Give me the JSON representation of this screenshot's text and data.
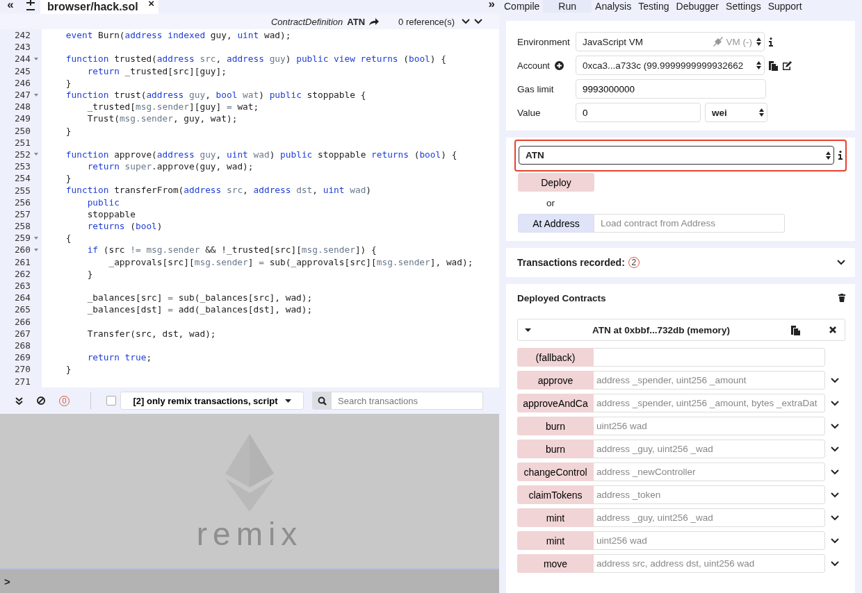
{
  "editor": {
    "file_tab": {
      "label": "browser/hack.sol",
      "close": "×"
    },
    "nav_left": "«",
    "nav_right": "»",
    "header": {
      "kind_label": "ContractDefinition",
      "name": "ATN",
      "references": "0 reference(s)"
    },
    "lines": [
      {
        "number": "242",
        "fold": false,
        "tokens": [
          {
            "kind": "keyword",
            "text": "    event"
          },
          {
            "kind": "plain",
            "text": " Burn("
          },
          {
            "kind": "keyword",
            "text": "address indexed"
          },
          {
            "kind": "plain",
            "text": " guy, "
          },
          {
            "kind": "keyword",
            "text": "uint"
          },
          {
            "kind": "plain",
            "text": " wad);"
          }
        ]
      },
      {
        "number": "243",
        "fold": false
      },
      {
        "number": "244",
        "fold": true,
        "tokens": [
          {
            "kind": "keyword",
            "text": "    function"
          },
          {
            "kind": "plain",
            "text": " trusted("
          },
          {
            "kind": "keyword",
            "text": "address"
          },
          {
            "kind": "param",
            "text": " src"
          },
          {
            "kind": "plain",
            "text": ", "
          },
          {
            "kind": "keyword",
            "text": "address"
          },
          {
            "kind": "param",
            "text": " guy"
          },
          {
            "kind": "plain",
            "text": ") "
          },
          {
            "kind": "keyword",
            "text": "public view returns"
          },
          {
            "kind": "plain",
            "text": " ("
          },
          {
            "kind": "keyword",
            "text": "bool"
          },
          {
            "kind": "plain",
            "text": ") {"
          }
        ]
      },
      {
        "number": "245",
        "fold": false,
        "tokens": [
          {
            "kind": "keyword",
            "text": "        return"
          },
          {
            "kind": "plain",
            "text": " _trusted[src][guy];"
          }
        ]
      },
      {
        "number": "246",
        "fold": false,
        "tokens": [
          {
            "kind": "plain",
            "text": "    }"
          }
        ]
      },
      {
        "number": "247",
        "fold": true,
        "tokens": [
          {
            "kind": "keyword",
            "text": "    function"
          },
          {
            "kind": "plain",
            "text": " trust("
          },
          {
            "kind": "keyword",
            "text": "address"
          },
          {
            "kind": "param",
            "text": " guy"
          },
          {
            "kind": "plain",
            "text": ", "
          },
          {
            "kind": "keyword",
            "text": "bool"
          },
          {
            "kind": "param",
            "text": " wat"
          },
          {
            "kind": "plain",
            "text": ") "
          },
          {
            "kind": "keyword",
            "text": "public"
          },
          {
            "kind": "plain",
            "text": " stoppable {"
          }
        ]
      },
      {
        "number": "248",
        "fold": false,
        "tokens": [
          {
            "kind": "plain",
            "text": "        _trusted["
          },
          {
            "kind": "param",
            "text": "msg.sender"
          },
          {
            "kind": "plain",
            "text": "][guy] "
          },
          {
            "kind": "param",
            "text": "="
          },
          {
            "kind": "plain",
            "text": " wat;"
          }
        ]
      },
      {
        "number": "249",
        "fold": false,
        "tokens": [
          {
            "kind": "plain",
            "text": "        Trust("
          },
          {
            "kind": "param",
            "text": "msg.sender"
          },
          {
            "kind": "plain",
            "text": ", guy, wat);"
          }
        ]
      },
      {
        "number": "250",
        "fold": false,
        "tokens": [
          {
            "kind": "plain",
            "text": "    }"
          }
        ]
      },
      {
        "number": "251",
        "fold": false
      },
      {
        "number": "252",
        "fold": true,
        "tokens": [
          {
            "kind": "keyword",
            "text": "    function"
          },
          {
            "kind": "plain",
            "text": " approve("
          },
          {
            "kind": "keyword",
            "text": "address"
          },
          {
            "kind": "param",
            "text": " guy"
          },
          {
            "kind": "plain",
            "text": ", "
          },
          {
            "kind": "keyword",
            "text": "uint"
          },
          {
            "kind": "param",
            "text": " wad"
          },
          {
            "kind": "plain",
            "text": ") "
          },
          {
            "kind": "keyword",
            "text": "public"
          },
          {
            "kind": "plain",
            "text": " stoppable "
          },
          {
            "kind": "keyword",
            "text": "returns"
          },
          {
            "kind": "plain",
            "text": " ("
          },
          {
            "kind": "keyword",
            "text": "bool"
          },
          {
            "kind": "plain",
            "text": ") {"
          }
        ]
      },
      {
        "number": "253",
        "fold": false,
        "tokens": [
          {
            "kind": "keyword",
            "text": "        return"
          },
          {
            "kind": "param",
            "text": " super"
          },
          {
            "kind": "plain",
            "text": ".approve(guy, wad);"
          }
        ]
      },
      {
        "number": "254",
        "fold": false,
        "tokens": [
          {
            "kind": "plain",
            "text": "    }"
          }
        ]
      },
      {
        "number": "255",
        "fold": false,
        "tokens": [
          {
            "kind": "keyword",
            "text": "    function"
          },
          {
            "kind": "plain",
            "text": " transferFrom("
          },
          {
            "kind": "keyword",
            "text": "address"
          },
          {
            "kind": "param",
            "text": " src"
          },
          {
            "kind": "plain",
            "text": ", "
          },
          {
            "kind": "keyword",
            "text": "address"
          },
          {
            "kind": "param",
            "text": " dst"
          },
          {
            "kind": "plain",
            "text": ", "
          },
          {
            "kind": "keyword",
            "text": "uint"
          },
          {
            "kind": "param",
            "text": " wad"
          },
          {
            "kind": "plain",
            "text": ")"
          }
        ]
      },
      {
        "number": "256",
        "fold": false,
        "tokens": [
          {
            "kind": "keyword",
            "text": "        public"
          }
        ]
      },
      {
        "number": "257",
        "fold": false,
        "tokens": [
          {
            "kind": "plain",
            "text": "        stoppable"
          }
        ]
      },
      {
        "number": "258",
        "fold": false,
        "tokens": [
          {
            "kind": "keyword",
            "text": "        returns"
          },
          {
            "kind": "plain",
            "text": " ("
          },
          {
            "kind": "keyword",
            "text": "bool"
          },
          {
            "kind": "plain",
            "text": ")"
          }
        ]
      },
      {
        "number": "259",
        "fold": true,
        "tokens": [
          {
            "kind": "plain",
            "text": "    {"
          }
        ]
      },
      {
        "number": "260",
        "fold": true,
        "tokens": [
          {
            "kind": "keyword",
            "text": "        if"
          },
          {
            "kind": "plain",
            "text": " (src "
          },
          {
            "kind": "param",
            "text": "!= msg.sender"
          },
          {
            "kind": "plain",
            "text": " && !_trusted[src]["
          },
          {
            "kind": "param",
            "text": "msg.sender"
          },
          {
            "kind": "plain",
            "text": "]) {"
          }
        ]
      },
      {
        "number": "261",
        "fold": false,
        "tokens": [
          {
            "kind": "plain",
            "text": "            _approvals[src]["
          },
          {
            "kind": "param",
            "text": "msg.sender"
          },
          {
            "kind": "plain",
            "text": "] "
          },
          {
            "kind": "param",
            "text": "="
          },
          {
            "kind": "plain",
            "text": " sub(_approvals[src]["
          },
          {
            "kind": "param",
            "text": "msg.sender"
          },
          {
            "kind": "plain",
            "text": "], wad);"
          }
        ]
      },
      {
        "number": "262",
        "fold": false,
        "tokens": [
          {
            "kind": "plain",
            "text": "        }"
          }
        ]
      },
      {
        "number": "263",
        "fold": false
      },
      {
        "number": "264",
        "fold": false,
        "tokens": [
          {
            "kind": "plain",
            "text": "        _balances[src] "
          },
          {
            "kind": "param",
            "text": "="
          },
          {
            "kind": "plain",
            "text": " sub(_balances[src], wad);"
          }
        ]
      },
      {
        "number": "265",
        "fold": false,
        "tokens": [
          {
            "kind": "plain",
            "text": "        _balances[dst] "
          },
          {
            "kind": "param",
            "text": "="
          },
          {
            "kind": "plain",
            "text": " add(_balances[dst], wad);"
          }
        ]
      },
      {
        "number": "266",
        "fold": false
      },
      {
        "number": "267",
        "fold": false,
        "tokens": [
          {
            "kind": "plain",
            "text": "        Transfer(src, dst, wad);"
          }
        ]
      },
      {
        "number": "268",
        "fold": false
      },
      {
        "number": "269",
        "fold": false,
        "tokens": [
          {
            "kind": "keyword",
            "text": "        return true"
          },
          {
            "kind": "plain",
            "text": ";"
          }
        ]
      },
      {
        "number": "270",
        "fold": false,
        "tokens": [
          {
            "kind": "plain",
            "text": "    }"
          }
        ]
      },
      {
        "number": "271",
        "fold": false
      }
    ]
  },
  "terminal": {
    "error_count": "0",
    "filter_checked": false,
    "filter": "[2] only remix transactions, script",
    "search": {
      "placeholder": "Search transactions"
    },
    "logo_text": "remix",
    "prompt": ">"
  },
  "tabs": [
    {
      "label": "Compile",
      "selected": false
    },
    {
      "label": "Run",
      "selected": true
    },
    {
      "label": "Analysis",
      "selected": false
    },
    {
      "label": "Testing",
      "selected": false
    },
    {
      "label": "Debugger",
      "selected": false
    },
    {
      "label": "Settings",
      "selected": false
    },
    {
      "label": "Support",
      "selected": false
    }
  ],
  "settings": {
    "environment": {
      "label": "Environment",
      "value": "JavaScript VM",
      "network": "VM (-)"
    },
    "account": {
      "label": "Account",
      "value": "0xca3...a733c (99.9999999999932662"
    },
    "gas_limit": {
      "label": "Gas limit",
      "value": "9993000000"
    },
    "value": {
      "label": "Value",
      "value": "0",
      "unit": "wei"
    }
  },
  "contract": {
    "value": "ATN",
    "highlighted": true,
    "deploy": "Deploy",
    "or": "or",
    "at_address": "At Address",
    "address_field": {
      "placeholder": "Load contract from Address"
    }
  },
  "transactions": {
    "label": "Transactions recorded:",
    "count": "2"
  },
  "deployed": {
    "title": "Deployed Contracts",
    "instance": "ATN at 0xbbf...732db (memory)",
    "functions": [
      {
        "kind": "fallback",
        "name": "(fallback)"
      },
      {
        "kind": "function",
        "name": "approve",
        "placeholder": "address _spender, uint256 _amount"
      },
      {
        "kind": "function",
        "name": "approveAndCa",
        "placeholder": "address _spender, uint256 _amount, bytes _extraDat"
      },
      {
        "kind": "function",
        "name": "burn",
        "placeholder": "uint256 wad"
      },
      {
        "kind": "function",
        "name": "burn",
        "placeholder": "address _guy, uint256 _wad"
      },
      {
        "kind": "function",
        "name": "changeControl",
        "placeholder": "address _newController"
      },
      {
        "kind": "function",
        "name": "claimTokens",
        "placeholder": "address _token"
      },
      {
        "kind": "function",
        "name": "mint",
        "placeholder": "address _guy, uint256 _wad"
      },
      {
        "kind": "function",
        "name": "mint",
        "placeholder": "uint256 wad"
      },
      {
        "kind": "function",
        "name": "move",
        "placeholder": "address src, address dst, uint256 wad"
      }
    ]
  }
}
